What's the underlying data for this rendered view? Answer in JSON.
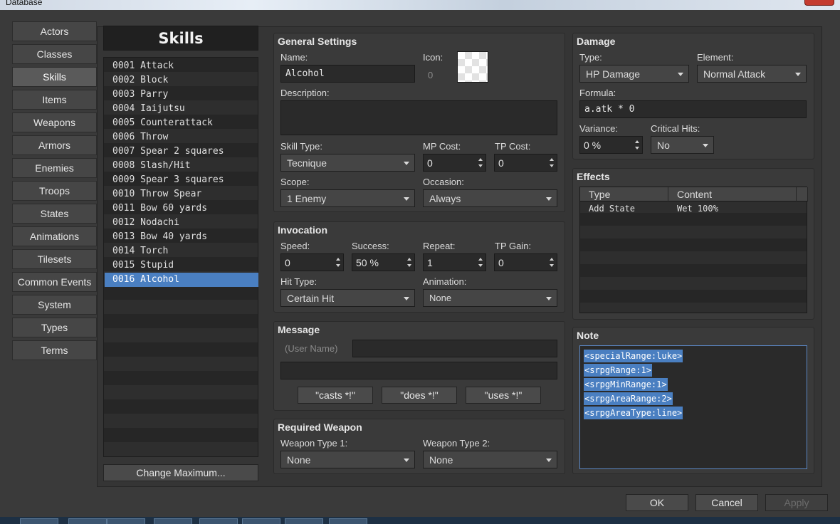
{
  "window": {
    "title": "Database"
  },
  "nav": {
    "items": [
      "Actors",
      "Classes",
      "Skills",
      "Items",
      "Weapons",
      "Armors",
      "Enemies",
      "Troops",
      "States",
      "Animations",
      "Tilesets",
      "Common Events",
      "System",
      "Types",
      "Terms"
    ],
    "active": "Skills"
  },
  "list": {
    "header": "Skills",
    "items": [
      "0001 Attack",
      "0002 Block",
      "0003 Parry",
      "0004 Iaijutsu",
      "0005 Counterattack",
      "0006 Throw",
      "0007 Spear 2 squares",
      "0008 Slash/Hit",
      "0009 Spear 3 squares",
      "0010 Throw Spear",
      "0011 Bow 60 yards",
      "0012 Nodachi",
      "0013 Bow 40 yards",
      "0014 Torch",
      "0015 Stupid",
      "0016 Alcohol"
    ],
    "selected": "0016 Alcohol",
    "change_max_label": "Change Maximum..."
  },
  "general": {
    "title": "General Settings",
    "name_label": "Name:",
    "name_value": "Alcohol",
    "icon_label": "Icon:",
    "icon_index": "0",
    "description_label": "Description:",
    "description_value": "",
    "skill_type_label": "Skill Type:",
    "skill_type_value": "Tecnique",
    "mp_cost_label": "MP Cost:",
    "mp_cost_value": "0",
    "tp_cost_label": "TP Cost:",
    "tp_cost_value": "0",
    "scope_label": "Scope:",
    "scope_value": "1 Enemy",
    "occasion_label": "Occasion:",
    "occasion_value": "Always"
  },
  "invocation": {
    "title": "Invocation",
    "speed_label": "Speed:",
    "speed_value": "0",
    "success_label": "Success:",
    "success_value": "50 %",
    "repeat_label": "Repeat:",
    "repeat_value": "1",
    "tp_gain_label": "TP Gain:",
    "tp_gain_value": "0",
    "hit_type_label": "Hit Type:",
    "hit_type_value": "Certain Hit",
    "animation_label": "Animation:",
    "animation_value": "None"
  },
  "message": {
    "title": "Message",
    "user_name_placeholder": "(User Name)",
    "line1_value": "",
    "line2_value": "",
    "buttons": [
      "\"casts *!\"",
      "\"does *!\"",
      "\"uses *!\""
    ]
  },
  "required_weapon": {
    "title": "Required Weapon",
    "type1_label": "Weapon Type 1:",
    "type1_value": "None",
    "type2_label": "Weapon Type 2:",
    "type2_value": "None"
  },
  "damage": {
    "title": "Damage",
    "type_label": "Type:",
    "type_value": "HP Damage",
    "element_label": "Element:",
    "element_value": "Normal Attack",
    "formula_label": "Formula:",
    "formula_value": "a.atk * 0",
    "variance_label": "Variance:",
    "variance_value": "0 %",
    "critical_label": "Critical Hits:",
    "critical_value": "No"
  },
  "effects": {
    "title": "Effects",
    "columns": [
      "Type",
      "Content"
    ],
    "rows": [
      {
        "type": "Add State",
        "content": "Wet 100%"
      }
    ]
  },
  "note": {
    "title": "Note",
    "lines": [
      "<specialRange:luke>",
      "<srpgRange:1>",
      "<srpgMinRange:1>",
      "<srpgAreaRange:2>",
      "<srpgAreaType:line>"
    ]
  },
  "dialog_buttons": {
    "ok": "OK",
    "cancel": "Cancel",
    "apply": "Apply"
  },
  "colors": {
    "selection": "#4a7fc1",
    "panel": "#3a3a3a",
    "field": "#2a2a2a"
  }
}
